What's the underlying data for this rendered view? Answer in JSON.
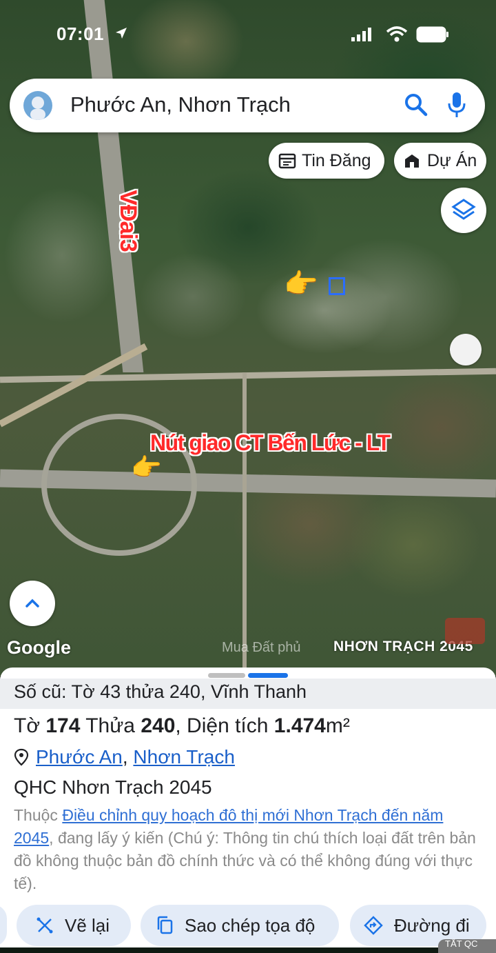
{
  "status_bar": {
    "time": "07:01"
  },
  "search": {
    "query": "Phước An, Nhơn Trạch"
  },
  "chips": {
    "listings": "Tin Đăng",
    "projects": "Dự Án"
  },
  "map_overlay": {
    "road_label": "VĐai3",
    "junction_label": "Nút giao CT Bến Lức - LT",
    "google_logo": "Google",
    "watermark": "Mua Đất phủ",
    "watermark_brand": "NHƠN TRẠCH 2045"
  },
  "sheet": {
    "old_number": "Số cũ: Tờ 43 thửa 240, Vĩnh Thanh",
    "title": {
      "sheet_label": "Tờ",
      "sheet_no": "174",
      "plot_label": "Thửa",
      "plot_no": "240",
      "area_label": ", Diện tích",
      "area_value": "1.474",
      "area_unit": "m²"
    },
    "location": {
      "ward": "Phước An",
      "separator": ",",
      "district": "Nhơn Trạch"
    },
    "plan_name": "QHC Nhơn Trạch 2045",
    "description": {
      "prefix": "Thuộc",
      "link": "Điều chỉnh quy hoạch đô thị mới Nhơn Trạch đến năm 2045",
      "suffix": ", đang lấy ý kiến (Chú ý: Thông tin chú thích loại đất trên bản đồ không thuộc bản đồ chính thức và có thể không đúng với thực tế)."
    },
    "actions": {
      "redraw": "Vẽ lại",
      "copy_coords": "Sao chép tọa độ",
      "directions": "Đường đi"
    },
    "close_pill": "TẮT QC"
  },
  "colors": {
    "accent": "#1a73e8",
    "annotation": "#ff2a2a",
    "button_bg": "#e3ebf7"
  }
}
